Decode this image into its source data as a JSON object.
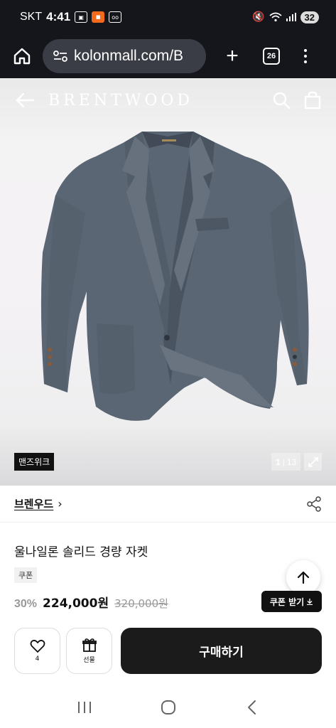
{
  "status_bar": {
    "carrier": "SKT",
    "time": "4:41",
    "battery": "32"
  },
  "browser": {
    "url": "kolonmall.com/B",
    "tab_count": "26"
  },
  "header": {
    "brand_logo": "BRENTWOOD"
  },
  "gallery": {
    "tag": "맨즈위크",
    "current": "1",
    "total": "13"
  },
  "brand_row": {
    "brand_name": "브렌우드"
  },
  "product": {
    "title": "울나일론 솔리드 경량 자켓",
    "coupon_badge": "쿠폰",
    "discount": "30%",
    "sale_price": "224,000원",
    "original_price": "320,000원",
    "coupon_button": "쿠폰 받기"
  },
  "actions": {
    "like_count": "4",
    "gift_label": "선물",
    "buy_label": "구매하기"
  },
  "colors": {
    "accent": "#111111",
    "status_bar_bg": "#14161c",
    "jacket": "#5b6674"
  }
}
